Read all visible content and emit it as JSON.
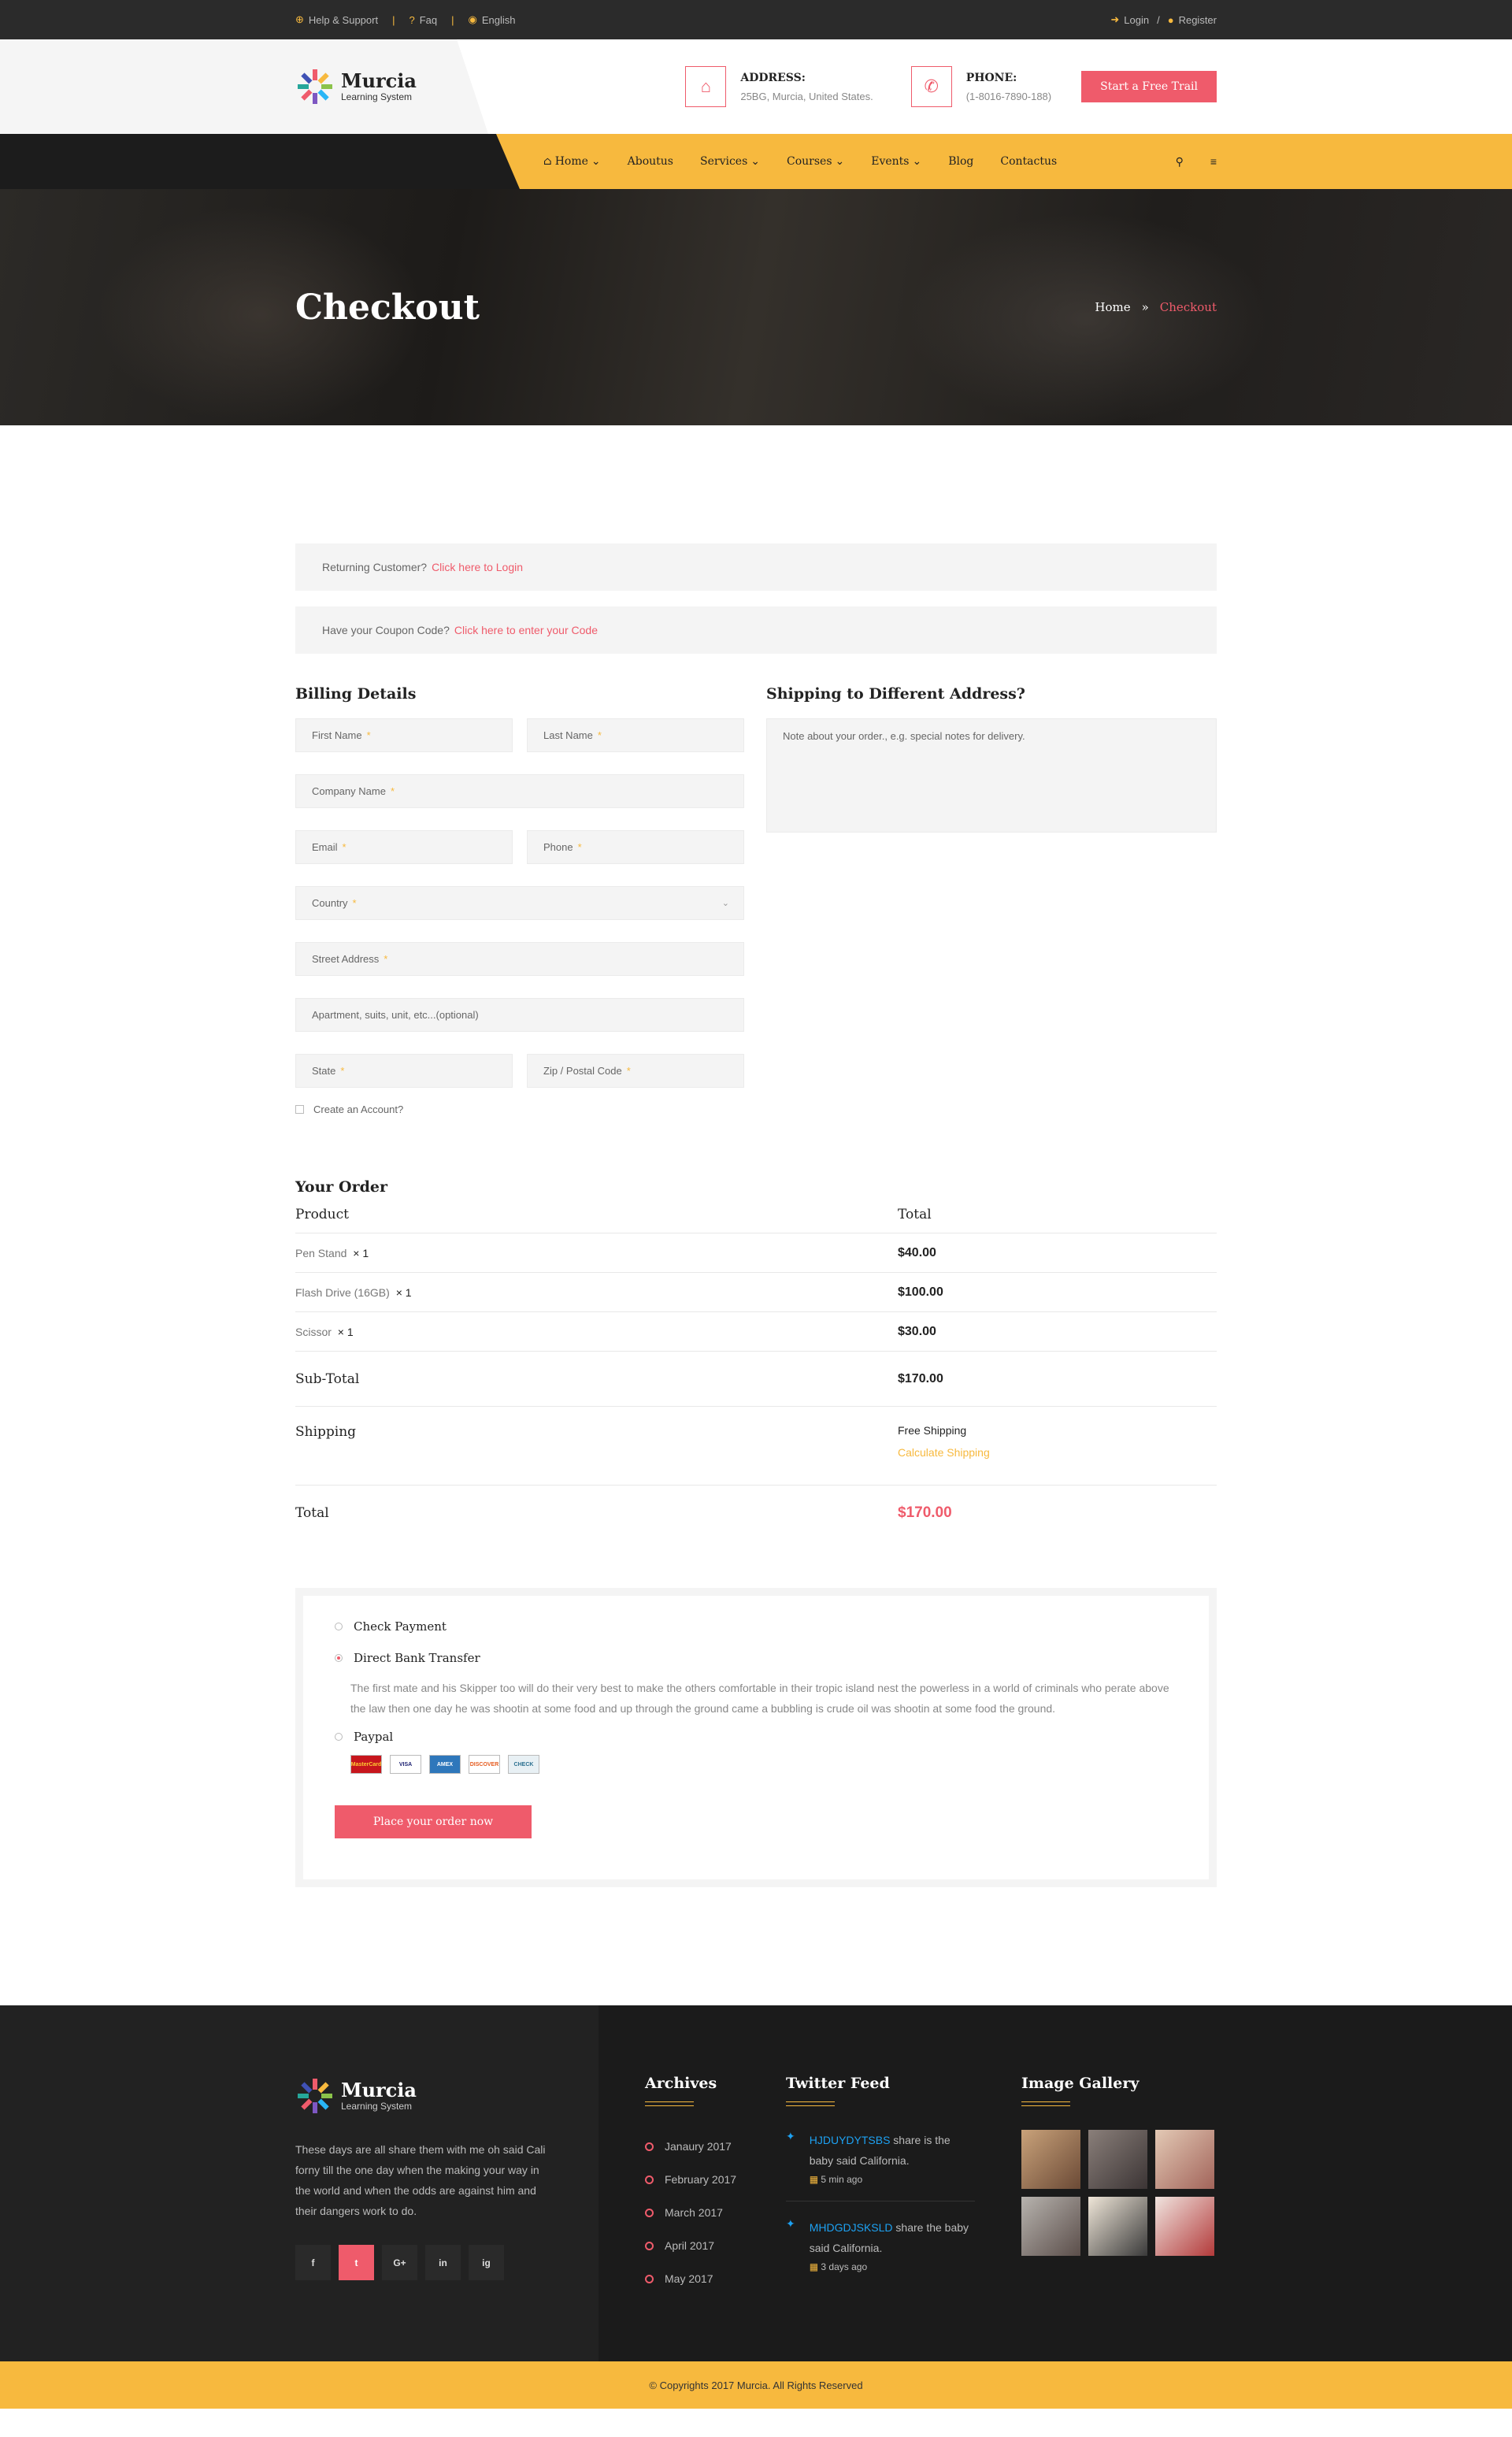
{
  "topbar": {
    "help": "Help & Support",
    "faq": "Faq",
    "lang": "English",
    "login": "Login",
    "register": "Register"
  },
  "header": {
    "logo_title": "Murcia",
    "logo_sub": "Learning System",
    "address_label": "ADDRESS:",
    "address_value": "25BG, Murcia, United States.",
    "phone_label": "PHONE:",
    "phone_value": "(1-8016-7890-188)",
    "cta": "Start a Free Trail"
  },
  "nav": {
    "items": [
      "Home",
      "Aboutus",
      "Services",
      "Courses",
      "Events",
      "Blog",
      "Contactus"
    ]
  },
  "hero": {
    "title": "Checkout",
    "crumb_home": "Home",
    "crumb_current": "Checkout"
  },
  "notices": {
    "returning": "Returning Customer?",
    "returning_link": "Click here to Login",
    "coupon": "Have your Coupon Code?",
    "coupon_link": "Click here to enter your Code"
  },
  "billing": {
    "title": "Billing Details",
    "first_name": "First Name",
    "last_name": "Last Name",
    "company": "Company Name",
    "email": "Email",
    "phone": "Phone",
    "country": "Country",
    "street": "Street Address",
    "apartment": "Apartment, suits, unit, etc...(optional)",
    "state": "State",
    "zip": "Zip / Postal Code",
    "create_account": "Create an Account?",
    "req": "*"
  },
  "shipping": {
    "title": "Shipping to Different Address?",
    "note": "Note about your order., e.g. special notes for delivery."
  },
  "order": {
    "title": "Your Order",
    "col_product": "Product",
    "col_total": "Total",
    "items": [
      {
        "name": "Pen Stand",
        "qty": "× 1",
        "price": "$40.00"
      },
      {
        "name": "Flash Drive (16GB)",
        "qty": "× 1",
        "price": "$100.00"
      },
      {
        "name": "Scissor",
        "qty": "× 1",
        "price": "$30.00"
      }
    ],
    "subtotal_label": "Sub-Total",
    "subtotal": "$170.00",
    "shipping_label": "Shipping",
    "shipping_free": "Free Shipping",
    "shipping_calc": "Calculate Shipping",
    "total_label": "Total",
    "total": "$170.00"
  },
  "payment": {
    "check": "Check Payment",
    "bank": "Direct Bank Transfer",
    "bank_desc": "The first mate and his Skipper too will do their very best to make the others comfortable in their tropic island nest the powerless in a world of criminals who perate above the law then one day he was shootin at some food and up through the ground came a bubbling is crude oil was shootin at some food the ground.",
    "paypal": "Paypal",
    "cards": [
      "MasterCard",
      "VISA",
      "AMEX",
      "DISCOVER",
      "CHECK"
    ],
    "button": "Place your order now"
  },
  "footer": {
    "logo_title": "Murcia",
    "logo_sub": "Learning System",
    "about": "These days are all share them with me oh said Cali forny till the one day when the making your way in the world  and when the odds are against him and their dangers work to do.",
    "social": [
      "f",
      "t",
      "G+",
      "in",
      "ig"
    ],
    "archives_title": "Archives",
    "archives": [
      "Janaury 2017",
      "February 2017",
      "March 2017",
      "April 2017",
      "May 2017"
    ],
    "twitter_title": "Twitter Feed",
    "tweets": [
      {
        "handle": "HJDUYDYTSBS",
        "text": " share is the baby said California.",
        "time": "5 min ago"
      },
      {
        "handle": "MHDGDJSKSLD",
        "text": " share the baby said California.",
        "time": "3 days ago"
      }
    ],
    "gallery_title": "Image Gallery",
    "copyright": "© Copyrights 2017 Murcia. All Rights Reserved"
  },
  "colors": {
    "accent": "#ef5b6b",
    "yellow": "#f7b93e",
    "dark": "#1b1b1b"
  }
}
